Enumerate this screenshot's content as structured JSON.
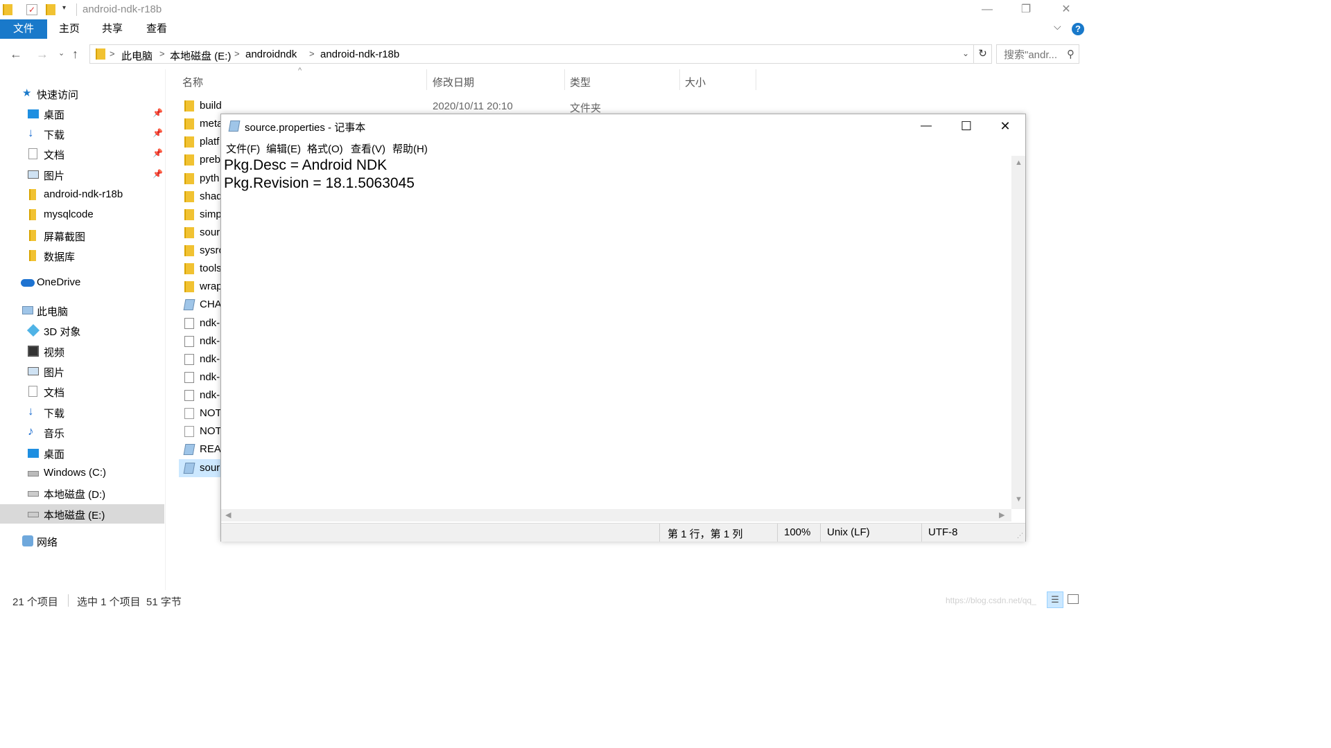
{
  "window": {
    "title": "android-ndk-r18b",
    "minimize": "—",
    "restore": "❐",
    "close": "✕"
  },
  "ribbon": {
    "tabs": [
      "文件",
      "主页",
      "共享",
      "查看"
    ],
    "expand": "⌵",
    "help": "?"
  },
  "address": {
    "crumbs": [
      "此电脑",
      "本地磁盘 (E:)",
      "androidndk",
      "android-ndk-r18b"
    ],
    "search_placeholder": "搜索\"andr...",
    "refresh": "↻"
  },
  "navpane": {
    "quick_access": "快速访问",
    "quick_items": [
      "桌面",
      "下载",
      "文档",
      "图片",
      "android-ndk-r18b",
      "mysqlcode",
      "屏幕截图",
      "数据库"
    ],
    "onedrive": "OneDrive",
    "this_pc": "此电脑",
    "pc_items": [
      "3D 对象",
      "视频",
      "图片",
      "文档",
      "下载",
      "音乐",
      "桌面",
      "Windows (C:)",
      "本地磁盘 (D:)",
      "本地磁盘 (E:)"
    ],
    "network": "网络"
  },
  "filelist": {
    "columns": [
      "名称",
      "修改日期",
      "类型",
      "大小"
    ],
    "first_row": {
      "date": "2020/10/11 20:10",
      "type": "文件夹"
    },
    "rows": [
      "build",
      "meta",
      "platf",
      "preb",
      "pyth",
      "shad",
      "simp",
      "sour",
      "sysro",
      "tools",
      "wrap",
      "CHA",
      "ndk-",
      "ndk-",
      "ndk-",
      "ndk-",
      "ndk-",
      "NOT",
      "NOT",
      "REA",
      "sour"
    ]
  },
  "statusbar": {
    "count": "21 个项目",
    "selected": "选中 1 个项目",
    "size": "51 字节"
  },
  "notepad": {
    "title": "source.properties - 记事本",
    "menu": [
      "文件(F)",
      "编辑(E)",
      "格式(O)",
      "查看(V)",
      "帮助(H)"
    ],
    "lines": [
      "Pkg.Desc = Android NDK",
      "Pkg.Revision = 18.1.5063045"
    ],
    "status": {
      "position": "第 1 行，第 1 列",
      "zoom": "100%",
      "eol": "Unix (LF)",
      "encoding": "UTF-8"
    }
  },
  "watermark": "https://blog.csdn.net/qq_"
}
